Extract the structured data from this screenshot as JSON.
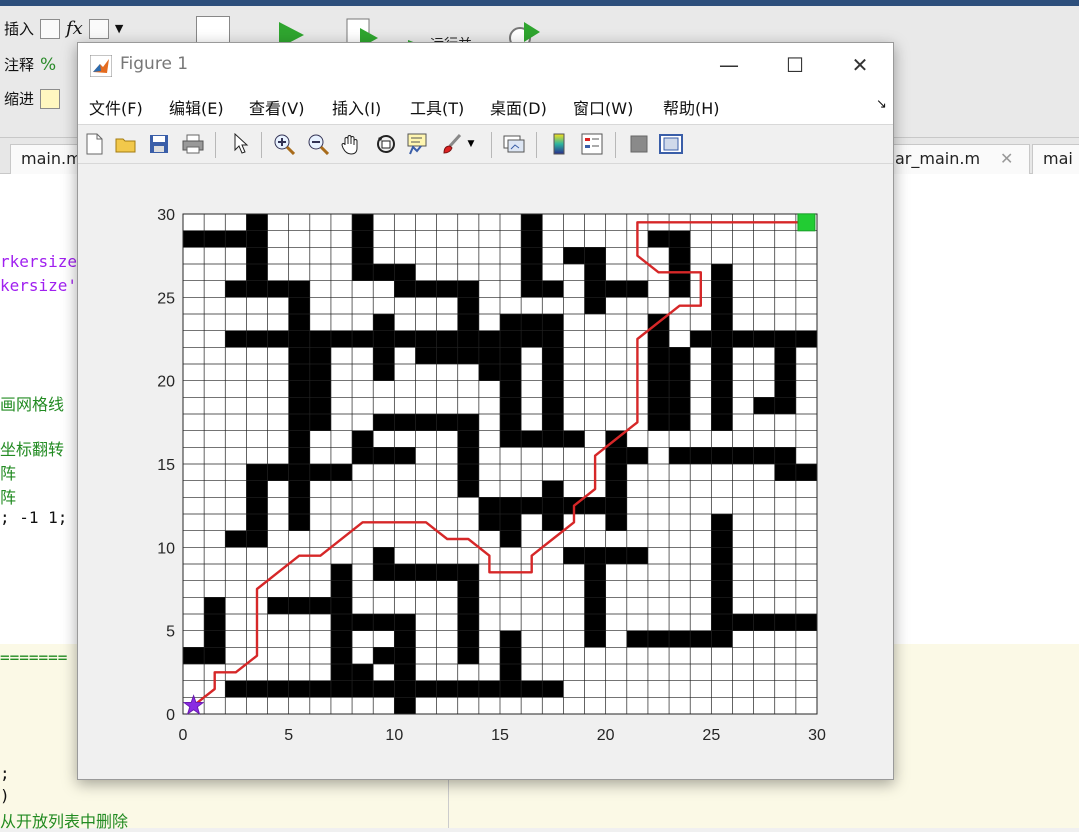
{
  "background": {
    "toolstrip": {
      "insert_label": "插入",
      "comment_label": "注释",
      "indent_label": "缩进",
      "run_label": "运行并"
    },
    "tabs": [
      "main.m",
      "ar_main.m",
      "mai"
    ],
    "code_lines": [
      {
        "text": "rkersize",
        "color": "#a020f0"
      },
      {
        "text": "kersize'",
        "color": "#a020f0"
      },
      {
        "text": "画网格线",
        "color": "#228b22"
      },
      {
        "text": "坐标翻转",
        "color": "#228b22"
      },
      {
        "text": "阵",
        "color": "#228b22"
      },
      {
        "text": "阵",
        "color": "#228b22"
      },
      {
        "text": "; -1 1;",
        "color": "#111111"
      }
    ],
    "cmd_lines": [
      {
        "text": "=======",
        "color": "#228b22"
      },
      {
        "text": ";",
        "color": "#111111"
      },
      {
        "text": ")",
        "color": "#111111"
      },
      {
        "text": "从开放列表中删除",
        "color": "#228b22"
      }
    ]
  },
  "figure": {
    "title": "Figure 1",
    "menu": [
      "文件(F)",
      "编辑(E)",
      "查看(V)",
      "插入(I)",
      "工具(T)",
      "桌面(D)",
      "窗口(W)",
      "帮助(H)"
    ],
    "toolbar_icons": [
      "new-figure-icon",
      "open-icon",
      "save-icon",
      "print-icon",
      "pointer-icon",
      "zoom-in-icon",
      "zoom-out-icon",
      "pan-icon",
      "rotate-icon",
      "data-cursor-icon",
      "brush-icon",
      "brush-dropdown-icon",
      "link-plot-icon",
      "colorbar-icon",
      "legend-icon",
      "hide-plot-tools-icon",
      "show-plot-tools-icon"
    ]
  },
  "chart_data": {
    "type": "grid-map",
    "xlim": [
      0,
      30
    ],
    "ylim": [
      0,
      30
    ],
    "xticks": [
      "0",
      "5",
      "10",
      "15",
      "20",
      "25",
      "30"
    ],
    "yticks": [
      "0",
      "5",
      "10",
      "15",
      "20",
      "25",
      "30"
    ],
    "grid_cells": 30,
    "grid": true,
    "obstacle_color": "#000000",
    "path_color": "#d62728",
    "start": [
      0.5,
      0.5
    ],
    "goal": [
      29.5,
      29.5
    ],
    "start_marker": "star",
    "start_color": "#8a2be2",
    "goal_marker": "square",
    "goal_color": "#22cc33",
    "obstacles": [
      [
        0,
        3,
        2,
        4
      ],
      [
        1,
        3,
        2,
        7
      ],
      [
        2,
        1,
        13,
        2
      ],
      [
        7,
        2,
        9,
        3
      ],
      [
        4,
        6,
        7,
        7
      ],
      [
        7,
        3,
        8,
        9
      ],
      [
        10,
        0,
        11,
        6
      ],
      [
        9,
        3,
        11,
        4
      ],
      [
        8,
        5,
        10,
        6
      ],
      [
        13,
        1,
        18,
        2
      ],
      [
        15,
        1,
        16,
        5
      ],
      [
        9,
        8,
        14,
        9
      ],
      [
        9,
        8,
        10,
        10
      ],
      [
        13,
        3,
        14,
        8
      ],
      [
        2,
        10,
        4,
        11
      ],
      [
        3,
        10,
        4,
        15
      ],
      [
        3,
        14,
        8,
        15
      ],
      [
        5,
        13,
        6,
        18
      ],
      [
        5,
        11,
        6,
        16
      ],
      [
        8,
        15,
        11,
        16
      ],
      [
        8,
        15,
        9,
        17
      ],
      [
        9,
        17,
        14,
        18
      ],
      [
        13,
        13,
        14,
        18
      ],
      [
        14,
        12,
        18,
        13
      ],
      [
        14,
        11,
        16,
        12
      ],
      [
        15,
        10,
        16,
        12
      ],
      [
        18,
        9,
        22,
        10
      ],
      [
        19,
        4,
        20,
        10
      ],
      [
        17,
        11,
        18,
        14
      ],
      [
        18,
        12,
        21,
        13
      ],
      [
        20,
        11,
        21,
        17
      ],
      [
        21,
        15,
        22,
        16
      ],
      [
        2,
        22,
        18,
        23
      ],
      [
        5,
        16,
        6,
        26
      ],
      [
        6,
        17,
        7,
        23
      ],
      [
        9,
        20,
        10,
        24
      ],
      [
        11,
        21,
        15,
        22
      ],
      [
        14,
        20,
        16,
        21
      ],
      [
        15,
        16,
        16,
        24
      ],
      [
        16,
        16,
        19,
        17
      ],
      [
        17,
        16,
        18,
        24
      ],
      [
        16,
        23,
        18,
        24
      ],
      [
        2,
        25,
        5,
        26
      ],
      [
        3,
        25,
        4,
        30
      ],
      [
        0,
        28,
        3,
        29
      ],
      [
        8,
        27,
        9,
        30
      ],
      [
        8,
        26,
        11,
        27
      ],
      [
        10,
        25,
        12,
        26
      ],
      [
        11,
        25,
        14,
        26
      ],
      [
        13,
        23,
        14,
        26
      ],
      [
        16,
        25,
        18,
        26
      ],
      [
        16,
        26,
        17,
        30
      ],
      [
        18,
        27,
        20,
        28
      ],
      [
        19,
        24,
        20,
        28
      ],
      [
        20,
        25,
        22,
        26
      ],
      [
        22,
        20,
        23,
        24
      ],
      [
        23,
        17,
        24,
        22
      ],
      [
        22,
        17,
        23,
        20
      ],
      [
        23,
        25,
        24,
        29
      ],
      [
        22,
        28,
        24,
        29
      ],
      [
        25,
        17,
        26,
        27
      ],
      [
        25,
        19,
        26,
        22
      ],
      [
        24,
        22,
        30,
        23
      ],
      [
        28,
        19,
        29,
        23
      ],
      [
        27,
        18,
        29,
        19
      ],
      [
        23,
        15,
        29,
        16
      ],
      [
        28,
        14,
        30,
        15
      ],
      [
        25,
        5,
        26,
        12
      ],
      [
        25,
        5,
        30,
        6
      ],
      [
        21,
        4,
        26,
        5
      ],
      [
        23,
        4,
        25,
        5
      ]
    ],
    "path": [
      [
        0.5,
        0.5
      ],
      [
        1,
        1
      ],
      [
        1.5,
        1.5
      ],
      [
        1.5,
        2.5
      ],
      [
        2,
        2.5
      ],
      [
        2.5,
        2.5
      ],
      [
        3.5,
        3.5
      ],
      [
        3.5,
        7.5
      ],
      [
        4.5,
        8.5
      ],
      [
        5.5,
        9.5
      ],
      [
        6.5,
        9.5
      ],
      [
        8.5,
        11.5
      ],
      [
        11.5,
        11.5
      ],
      [
        12,
        11
      ],
      [
        12.5,
        10.5
      ],
      [
        13.5,
        10.5
      ],
      [
        14.5,
        9.5
      ],
      [
        14.5,
        8.5
      ],
      [
        16.5,
        8.5
      ],
      [
        16.5,
        9.5
      ],
      [
        17.5,
        10.5
      ],
      [
        18.5,
        11.5
      ],
      [
        18.5,
        12.5
      ],
      [
        19.5,
        13.5
      ],
      [
        19.5,
        15.5
      ],
      [
        20.5,
        16.5
      ],
      [
        21.5,
        17.5
      ],
      [
        21.5,
        22.5
      ],
      [
        23.5,
        24.5
      ],
      [
        24.5,
        24.5
      ],
      [
        24.5,
        26.5
      ],
      [
        22.5,
        26.5
      ],
      [
        21.5,
        27.5
      ],
      [
        21.5,
        29.5
      ],
      [
        29.5,
        29.5
      ]
    ]
  }
}
